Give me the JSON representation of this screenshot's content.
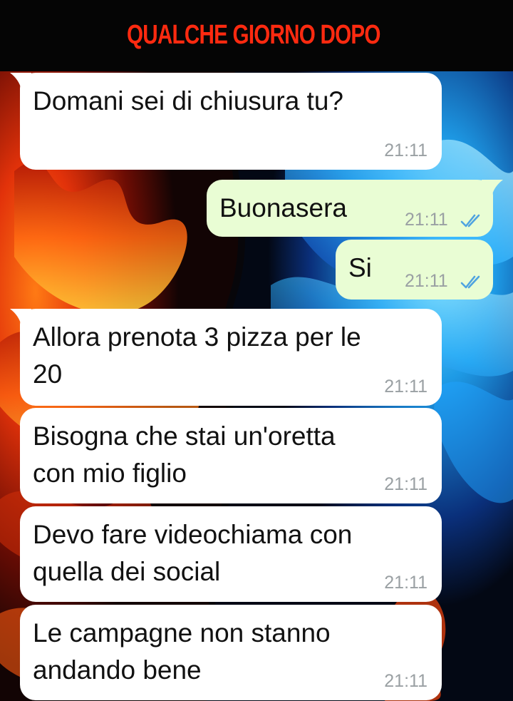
{
  "banner": {
    "title": "QUALCHE GIORNO DOPO"
  },
  "colors": {
    "banner_title": "#ff2a10",
    "incoming_bubble": "#ffffff",
    "outgoing_bubble": "#e9fdd4",
    "read_ticks": "#4fa3e0",
    "timestamp": "#9aa0a3"
  },
  "messages": [
    {
      "direction": "incoming",
      "line1": "Domani sei di chiusura tu?",
      "line2": "",
      "time": "21:11"
    },
    {
      "direction": "outgoing",
      "line1": "Buonasera",
      "line2": "",
      "time": "21:11",
      "status_icon": "double-check-read-icon"
    },
    {
      "direction": "outgoing",
      "line1": "Si",
      "line2": "",
      "time": "21:11",
      "status_icon": "double-check-read-icon"
    },
    {
      "direction": "incoming",
      "line1": "Allora prenota 3 pizza per le",
      "line2": "20",
      "time": "21:11"
    },
    {
      "direction": "incoming",
      "line1": "Bisogna che stai un'oretta",
      "line2": "con mio figlio",
      "time": "21:11"
    },
    {
      "direction": "incoming",
      "line1": "Devo fare videochiama con",
      "line2": "quella dei social",
      "time": "21:11"
    },
    {
      "direction": "incoming",
      "line1": "Le campagne non stanno",
      "line2": "andando bene",
      "time": "21:11"
    }
  ]
}
